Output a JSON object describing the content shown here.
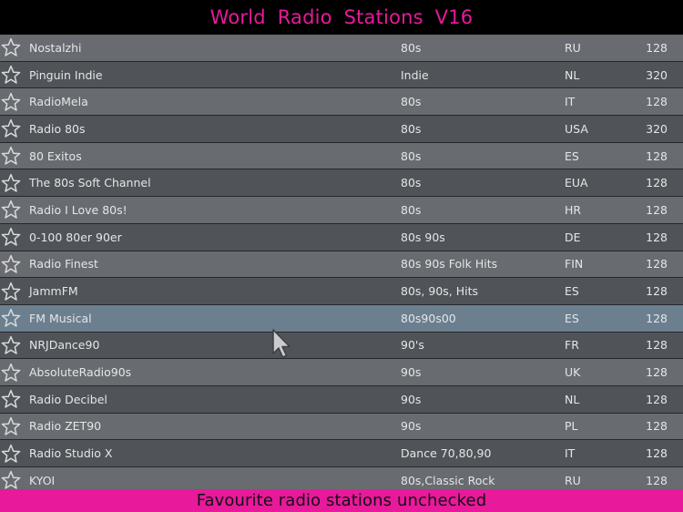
{
  "app": {
    "title": "World  Radio  Stations V16",
    "footer_status": "Favourite radio stations unchecked"
  },
  "colors": {
    "accent": "#e8199b",
    "row_light": "#686b70",
    "row_dark": "#505358",
    "row_selected": "#6b7f8f",
    "text": "#e4e6e8"
  },
  "stations": [
    {
      "name": "Nostalzhi",
      "genre": "80s",
      "country": "RU",
      "bitrate": "128",
      "favourite": false,
      "icon": "star-outline-icon"
    },
    {
      "name": "Pinguin Indie",
      "genre": "Indie",
      "country": "NL",
      "bitrate": "320",
      "favourite": false,
      "icon": "star-outline-icon"
    },
    {
      "name": "RadioMela",
      "genre": "80s",
      "country": "IT",
      "bitrate": "128",
      "favourite": false,
      "icon": "star-outline-icon"
    },
    {
      "name": "Radio 80s",
      "genre": "80s",
      "country": "USA",
      "bitrate": "320",
      "favourite": false,
      "icon": "star-outline-icon"
    },
    {
      "name": "80 Exitos",
      "genre": "80s",
      "country": "ES",
      "bitrate": "128",
      "favourite": false,
      "icon": "star-outline-icon"
    },
    {
      "name": "The 80s Soft Channel",
      "genre": "80s",
      "country": "EUA",
      "bitrate": "128",
      "favourite": false,
      "icon": "star-outline-icon"
    },
    {
      "name": "Radio I Love 80s!",
      "genre": "80s",
      "country": "HR",
      "bitrate": "128",
      "favourite": false,
      "icon": "star-outline-icon"
    },
    {
      "name": "0-100 80er 90er",
      "genre": "80s 90s",
      "country": "DE",
      "bitrate": "128",
      "favourite": false,
      "icon": "star-outline-icon"
    },
    {
      "name": "Radio Finest",
      "genre": "80s 90s Folk Hits",
      "country": "FIN",
      "bitrate": "128",
      "favourite": false,
      "icon": "star-outline-icon"
    },
    {
      "name": "JammFM",
      "genre": "80s, 90s, Hits",
      "country": "ES",
      "bitrate": "128",
      "favourite": false,
      "icon": "star-outline-icon"
    },
    {
      "name": "FM Musical",
      "genre": "80s90s00",
      "country": "ES",
      "bitrate": "128",
      "favourite": false,
      "icon": "star-outline-icon",
      "selected": true
    },
    {
      "name": "NRJDance90",
      "genre": "90's",
      "country": "FR",
      "bitrate": "128",
      "favourite": false,
      "icon": "star-outline-icon"
    },
    {
      "name": "AbsoluteRadio90s",
      "genre": "90s",
      "country": "UK",
      "bitrate": "128",
      "favourite": false,
      "icon": "star-outline-icon"
    },
    {
      "name": "Radio Decibel",
      "genre": "90s",
      "country": "NL",
      "bitrate": "128",
      "favourite": false,
      "icon": "star-outline-icon"
    },
    {
      "name": "Radio ZET90",
      "genre": "90s",
      "country": "PL",
      "bitrate": "128",
      "favourite": false,
      "icon": "star-outline-icon"
    },
    {
      "name": "Radio Studio X",
      "genre": "Dance 70,80,90",
      "country": "IT",
      "bitrate": "128",
      "favourite": false,
      "icon": "star-outline-icon"
    },
    {
      "name": "KYOI",
      "genre": "80s,Classic Rock",
      "country": "RU",
      "bitrate": "128",
      "favourite": false,
      "icon": "star-outline-icon"
    }
  ],
  "pointer": {
    "icon": "mouse-pointer-icon"
  }
}
